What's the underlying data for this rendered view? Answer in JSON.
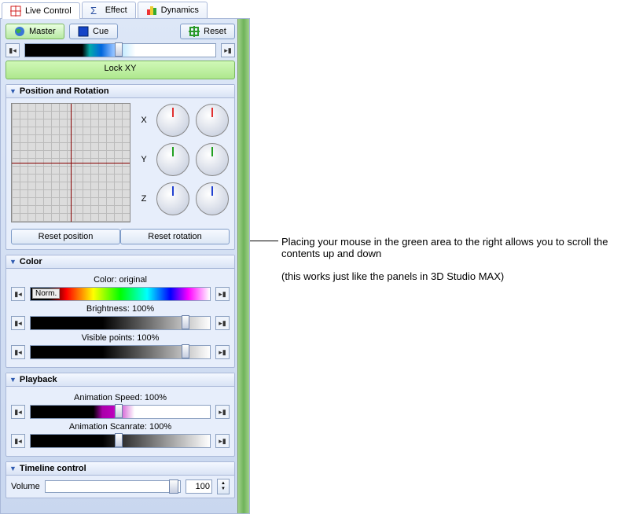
{
  "tabs": {
    "live": "Live Control",
    "effect": "Effect",
    "dynamics": "Dynamics"
  },
  "toolbar": {
    "master": "Master",
    "cue": "Cue",
    "reset": "Reset"
  },
  "lockxy": "Lock XY",
  "sections": {
    "posrot": "Position and Rotation",
    "color": "Color",
    "playback": "Playback",
    "timeline": "Timeline control"
  },
  "posrot": {
    "x": "X",
    "y": "Y",
    "z": "Z",
    "reset_position": "Reset position",
    "reset_rotation": "Reset rotation"
  },
  "color": {
    "title": "Color: original",
    "norm": "Norm.",
    "brightness": "Brightness: 100%",
    "visible": "Visible points: 100%"
  },
  "playback": {
    "speed": "Animation Speed: 100%",
    "scanrate": "Animation Scanrate: 100%"
  },
  "timeline": {
    "volume_label": "Volume",
    "volume_value": "100"
  },
  "annotation": {
    "line1": "Placing your mouse in the green area to the right allows you to scroll the contents up and down",
    "line2": "(this works just like the panels in 3D Studio MAX)"
  }
}
